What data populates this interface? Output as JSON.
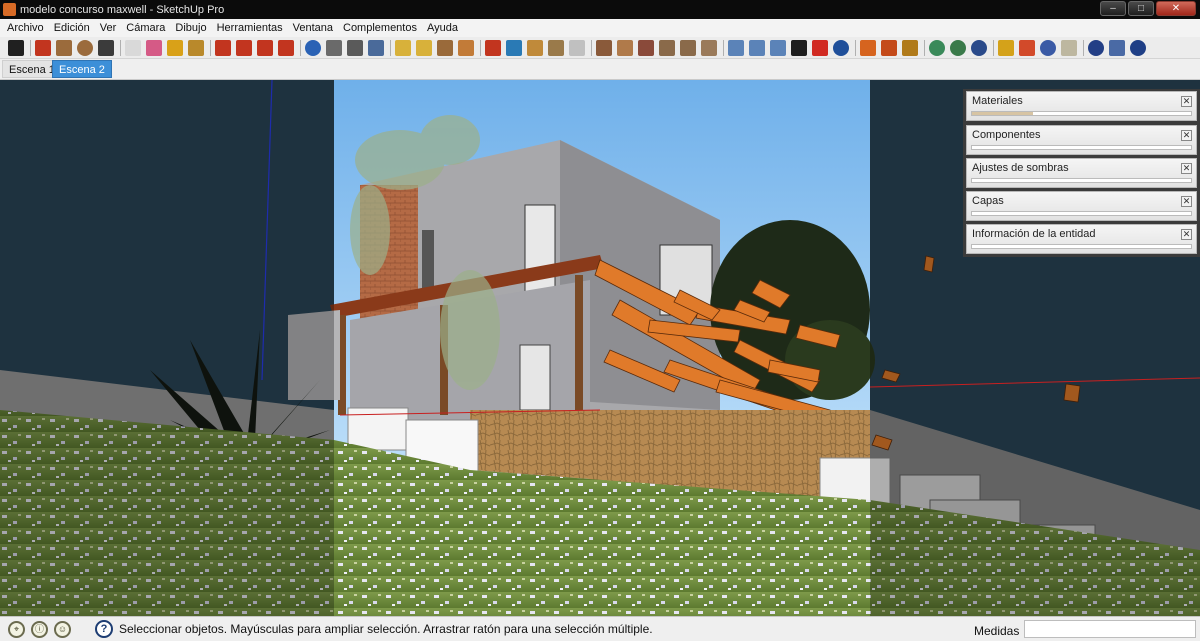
{
  "window": {
    "title": "modelo concurso maxwell - SketchUp Pro",
    "controls": [
      "minimize",
      "maximize",
      "close"
    ]
  },
  "menubar": {
    "items": [
      "Archivo",
      "Edición",
      "Ver",
      "Cámara",
      "Dibujo",
      "Herramientas",
      "Ventana",
      "Complementos",
      "Ayuda"
    ]
  },
  "toolbar": {
    "icons": [
      {
        "name": "select-icon",
        "color": "#202020"
      },
      {
        "name": "line-icon",
        "color": "#c2351f"
      },
      {
        "name": "rectangle-icon",
        "color": "#9b6b3c"
      },
      {
        "name": "circle-icon",
        "color": "#9b6b3c"
      },
      {
        "name": "arc-icon",
        "color": "#3b3b3b"
      },
      {
        "name": "make-component-icon",
        "color": "#d9d9d9"
      },
      {
        "name": "eraser-icon",
        "color": "#d55a86"
      },
      {
        "name": "tape-measure-icon",
        "color": "#d9a118"
      },
      {
        "name": "paint-bucket-icon",
        "color": "#b9892b"
      },
      {
        "name": "push-pull-icon",
        "color": "#c2351f"
      },
      {
        "name": "move-icon",
        "color": "#c2351f"
      },
      {
        "name": "rotate-icon",
        "color": "#c2351f"
      },
      {
        "name": "offset-icon",
        "color": "#c2351f"
      },
      {
        "name": "orbit-icon",
        "color": "#2a62b5"
      },
      {
        "name": "pan-icon",
        "color": "#6a6a6a"
      },
      {
        "name": "zoom-icon",
        "color": "#5a5a5a"
      },
      {
        "name": "zoom-extents-icon",
        "color": "#4a6a9a"
      },
      {
        "name": "previous-view-icon",
        "color": "#d8b13a"
      },
      {
        "name": "next-view-icon",
        "color": "#d8b13a"
      },
      {
        "name": "position-camera-icon",
        "color": "#9a6a3a"
      },
      {
        "name": "walk-icon",
        "color": "#c27b38"
      },
      {
        "name": "look-around-icon",
        "color": "#c2351f"
      },
      {
        "name": "get-models-icon",
        "color": "#2a7ab5"
      },
      {
        "name": "share-model-icon",
        "color": "#c08a3a"
      },
      {
        "name": "share-component-icon",
        "color": "#9a7a4a"
      },
      {
        "name": "component-icon",
        "color": "#c0c0c0"
      },
      {
        "name": "iso-view-icon",
        "color": "#8a5a3a"
      },
      {
        "name": "top-view-icon",
        "color": "#b07a4a"
      },
      {
        "name": "front-view-icon",
        "color": "#8a4a3a"
      },
      {
        "name": "right-view-icon",
        "color": "#8a6a4a"
      },
      {
        "name": "back-view-icon",
        "color": "#8a6a4a"
      },
      {
        "name": "left-view-icon",
        "color": "#9a7a5a"
      },
      {
        "name": "skin-icon",
        "color": "#5b83b8"
      },
      {
        "name": "xyz-icon",
        "color": "#5b83b8"
      },
      {
        "name": "rub-icon",
        "color": "#5b83b8"
      },
      {
        "name": "play-icon",
        "color": "#1e1e1e"
      },
      {
        "name": "stop-icon",
        "color": "#d12a22"
      },
      {
        "name": "refresh-icon",
        "color": "#1f4f9a"
      },
      {
        "name": "sandbox-icon",
        "color": "#d6641f"
      },
      {
        "name": "terrain-icon",
        "color": "#c44a1a"
      },
      {
        "name": "layer-icon",
        "color": "#b07a1a"
      },
      {
        "name": "globe-icon",
        "color": "#3a8a5a"
      },
      {
        "name": "geo-icon",
        "color": "#3a7a4a"
      },
      {
        "name": "info-icon",
        "color": "#2a4a8a"
      },
      {
        "name": "pencil-icon",
        "color": "#d4a21a"
      },
      {
        "name": "dropper-icon",
        "color": "#d24a2a"
      },
      {
        "name": "color-mix-icon",
        "color": "#3a5aa5"
      },
      {
        "name": "fd-icon",
        "color": "#bdb7a0"
      },
      {
        "name": "help-icon",
        "color": "#233f86"
      },
      {
        "name": "search-icon",
        "color": "#4a6aa5"
      },
      {
        "name": "about-icon",
        "color": "#1f3f86"
      }
    ]
  },
  "scenes": {
    "tabs": [
      "Escena 1",
      "Escena 2"
    ],
    "active": "Escena 2"
  },
  "trays": [
    {
      "title": "Materiales"
    },
    {
      "title": "Componentes"
    },
    {
      "title": "Ajustes de sombras"
    },
    {
      "title": "Capas"
    },
    {
      "title": "Información de la entidad"
    }
  ],
  "status": {
    "message": "Seleccionar objetos. Mayúsculas para ampliar selección. Arrastrar ratón para una selección múltiple.",
    "measure_label": "Medidas",
    "measure_value": ""
  }
}
